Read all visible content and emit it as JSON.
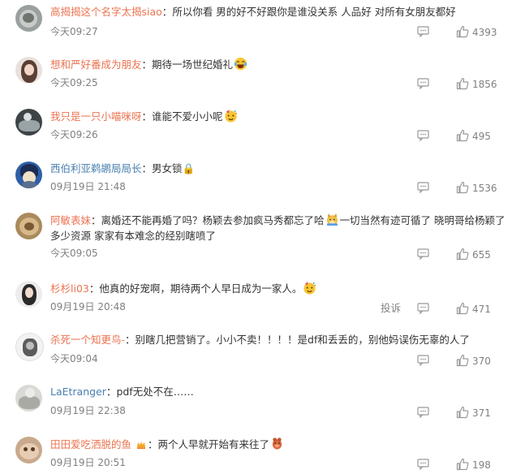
{
  "comments": [
    {
      "username": "高揭揭这个名字太揭siao",
      "text": "所以你看 男的好不好跟你是谁没关系 人品好 对所有女朋友都好",
      "time": "今天09:27",
      "likes": "4393"
    },
    {
      "username": "想和严好番成为朋友",
      "text": "期待一场世纪婚礼",
      "emoji": "laughing-tears-emoji",
      "time": "今天09:25",
      "likes": "1856"
    },
    {
      "username": "我只是一只小喵咪呀",
      "text": "谁能不爱小小呢",
      "emoji": "party-face-emoji",
      "time": "今天09:26",
      "likes": "495"
    },
    {
      "username": "西伯利亚鹈鹕局局长",
      "text": "男女锁🔒",
      "time": "09月19日 21:48",
      "likes": "1536"
    },
    {
      "username": "阿敏表妹",
      "text_part1": "离婚还不能再婚了吗？杨颖去参加疯马秀都忘了哈",
      "text_part2": "一切当然有迹可循了 晓明哥给杨颖了",
      "text_line2": "多少资源 家家有本难念的经别瞎喷了",
      "emoji": "doge-emoji",
      "time": "今天09:05",
      "likes": "655"
    },
    {
      "username": "杉杉li03",
      "text": "他真的好宠啊，期待两个人早日成为一家人。",
      "emoji": "party-face-emoji",
      "time": "09月19日 20:48",
      "report": "投诉",
      "likes": "471"
    },
    {
      "username": "杀死一个知更鸟-",
      "text": "别瞎几把营销了。小小不卖！！！！是df和丢丢的，别他妈误伤无辜的人了",
      "time": "今天09:04",
      "likes": "370"
    },
    {
      "username": "LaEtranger",
      "text": "pdf无处不在……",
      "time": "09月19日 22:38",
      "likes": "371"
    },
    {
      "username": "田田爱吃洒脱的鱼",
      "text": "两个人早就开始有来往了",
      "emoji": "pig-emoji",
      "time": "09月19日 20:51",
      "likes": "198"
    }
  ],
  "colors": {
    "username_orange": "#eb7350",
    "username_blue": "#4a7fb0",
    "meta_gray": "#808080",
    "text": "#333333"
  }
}
